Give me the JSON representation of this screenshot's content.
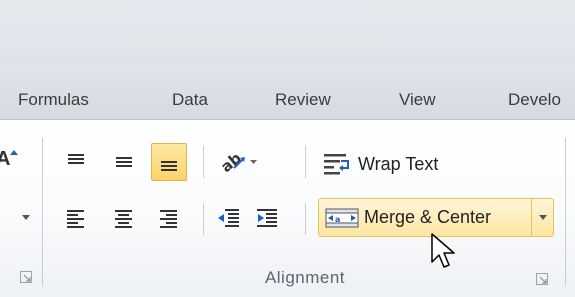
{
  "ribbon_tabs": [
    "Formulas",
    "Data",
    "Review",
    "View",
    "Develo"
  ],
  "alignment_group": {
    "label": "Alignment",
    "wrap_text_label": "Wrap Text",
    "merge_center_label": "Merge & Center",
    "bottom_align_selected": true
  },
  "left_partial_glyph": "A",
  "icons": {
    "top_align": "align-top-icon",
    "middle_align": "align-middle-icon",
    "bottom_align": "align-bottom-icon",
    "orientation": "text-orientation-icon",
    "align_left": "align-left-icon",
    "center": "align-center-icon",
    "align_right": "align-right-icon",
    "decrease_indent": "decrease-indent-icon",
    "increase_indent": "increase-indent-icon",
    "wrap_text": "wrap-text-icon",
    "merge_center": "merge-center-icon",
    "launcher": "dialog-launcher-icon",
    "cursor": "mouse-pointer-icon"
  },
  "colors": {
    "selected_fill": "#fbd36b",
    "hover_fill": "#fde6a2",
    "tab_bar": "#d6dbe2"
  }
}
